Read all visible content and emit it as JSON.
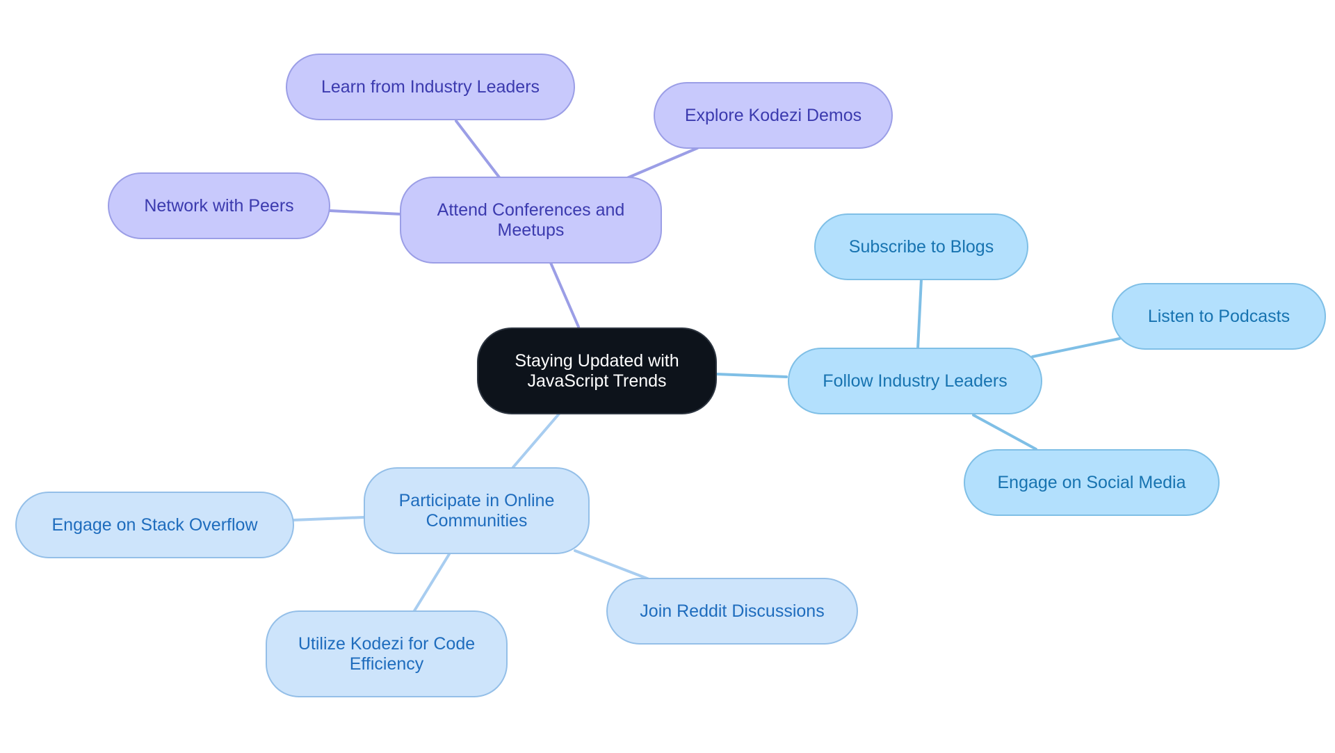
{
  "diagram": {
    "type": "mindmap",
    "root": {
      "label": "Staying Updated with JavaScript Trends"
    },
    "branches": [
      {
        "label": "Attend Conferences and Meetups",
        "color": "#9b9ee6",
        "children": [
          {
            "label": "Learn from Industry Leaders"
          },
          {
            "label": "Explore Kodezi Demos"
          },
          {
            "label": "Network with Peers"
          }
        ]
      },
      {
        "label": "Follow Industry Leaders",
        "color": "#7fbfe6",
        "children": [
          {
            "label": "Subscribe to Blogs"
          },
          {
            "label": "Listen to Podcasts"
          },
          {
            "label": "Engage on Social Media"
          }
        ]
      },
      {
        "label": "Participate in Online Communities",
        "color": "#a8cdf0",
        "children": [
          {
            "label": "Engage on Stack Overflow"
          },
          {
            "label": "Utilize Kodezi for Code Efficiency"
          },
          {
            "label": "Join Reddit Discussions"
          }
        ]
      }
    ]
  }
}
